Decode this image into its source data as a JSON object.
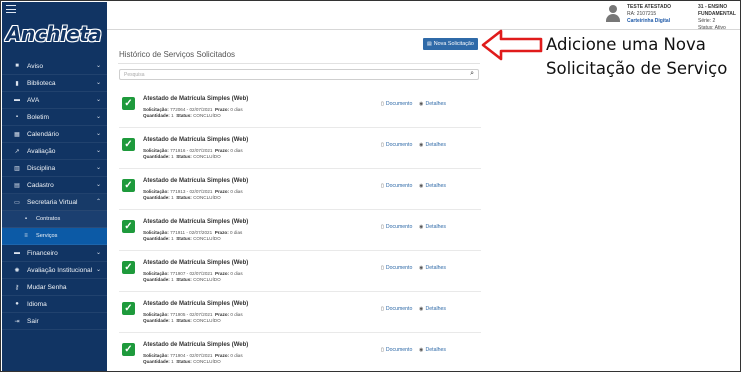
{
  "sidebar": {
    "logo": "Anchieta",
    "items": [
      {
        "icon": "megaphone-icon",
        "glyph": "■",
        "label": "Aviso",
        "chevron": true
      },
      {
        "icon": "book-icon",
        "glyph": "▮",
        "label": "Biblioteca",
        "chevron": true
      },
      {
        "icon": "monitor-icon",
        "glyph": "▬",
        "label": "AVA",
        "chevron": true
      },
      {
        "icon": "file-icon",
        "glyph": "▪",
        "label": "Boletim",
        "chevron": true
      },
      {
        "icon": "calendar-icon",
        "glyph": "▦",
        "label": "Calendário",
        "chevron": true
      },
      {
        "icon": "chart-icon",
        "glyph": "↗",
        "label": "Avaliação",
        "chevron": true
      },
      {
        "icon": "books-icon",
        "glyph": "▥",
        "label": "Disciplina",
        "chevron": true
      },
      {
        "icon": "id-card-icon",
        "glyph": "▤",
        "label": "Cadastro",
        "chevron": true
      },
      {
        "icon": "monitor-icon",
        "glyph": "▭",
        "label": "Secretaria Virtual",
        "chevron": true,
        "open": true
      },
      {
        "icon": "document-icon",
        "glyph": "▪",
        "label": "Contratos",
        "sub": true
      },
      {
        "icon": "list-icon",
        "glyph": "≡",
        "label": "Serviços",
        "sub": true,
        "active": true
      },
      {
        "icon": "money-icon",
        "glyph": "▬",
        "label": "Financeiro",
        "chevron": true
      },
      {
        "icon": "settings-icon",
        "glyph": "✺",
        "label": "Avaliação Institucional",
        "chevron": true
      },
      {
        "icon": "key-icon",
        "glyph": "⚷",
        "label": "Mudar Senha"
      },
      {
        "icon": "info-icon",
        "glyph": "●",
        "label": "Idioma"
      },
      {
        "icon": "logout-icon",
        "glyph": "⇥",
        "label": "Sair"
      }
    ]
  },
  "header": {
    "user_name": "TESTE ATESTADO",
    "ra": "RA: 2107215",
    "id_link": "Carteirinha Digital",
    "school": "31 - ENSINO FUNDAMENTAL",
    "serie": "Série: 2",
    "status": "Status: Ativo"
  },
  "main": {
    "title": "Histórico de Serviços Solicitados",
    "new_button": "Nova Solicitação",
    "search_placeholder": "Pesquisa",
    "doc_label": "Documento",
    "details_label": "Detalhes",
    "requests": [
      {
        "title": "Atestado de Matrícula Simples (Web)",
        "solicitacao": "772064 - 02/07/2021",
        "prazo": "0 dias",
        "quantidade": "1",
        "status": "CONCLUÍDO"
      },
      {
        "title": "Atestado de Matrícula Simples (Web)",
        "solicitacao": "771916 - 02/07/2021",
        "prazo": "0 dias",
        "quantidade": "1",
        "status": "CONCLUÍDO"
      },
      {
        "title": "Atestado de Matrícula Simples (Web)",
        "solicitacao": "771913 - 02/07/2021",
        "prazo": "0 dias",
        "quantidade": "1",
        "status": "CONCLUÍDO"
      },
      {
        "title": "Atestado de Matrícula Simples (Web)",
        "solicitacao": "771911 - 02/07/2021",
        "prazo": "0 dias",
        "quantidade": "1",
        "status": "CONCLUÍDO"
      },
      {
        "title": "Atestado de Matrícula Simples (Web)",
        "solicitacao": "771907 - 02/07/2021",
        "prazo": "0 dias",
        "quantidade": "1",
        "status": "CONCLUÍDO"
      },
      {
        "title": "Atestado de Matrícula Simples (Web)",
        "solicitacao": "771905 - 02/07/2021",
        "prazo": "0 dias",
        "quantidade": "1",
        "status": "CONCLUÍDO"
      },
      {
        "title": "Atestado de Matrícula Simples (Web)",
        "solicitacao": "771904 - 02/07/2021",
        "prazo": "0 dias",
        "quantidade": "1",
        "status": "CONCLUÍDO"
      }
    ]
  },
  "annotation": {
    "line1": "Adicione uma Nova",
    "line2": "Solicitação de Serviço",
    "arrow_color": "#e01b1b"
  },
  "labels": {
    "solicitacao": "Solicitação:",
    "prazo": "Prazo:",
    "quantidade": "Quantidade:",
    "status": "Status:"
  }
}
